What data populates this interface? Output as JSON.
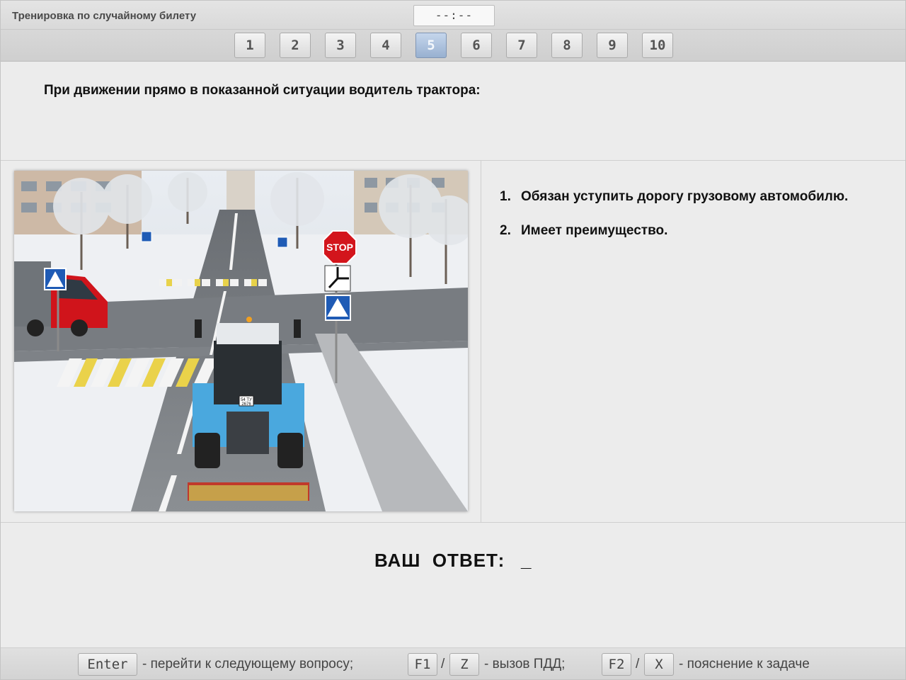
{
  "window": {
    "title": "Тренировка по случайному билету",
    "timer": "--:--"
  },
  "nav": {
    "questions": [
      "1",
      "2",
      "3",
      "4",
      "5",
      "6",
      "7",
      "8",
      "9",
      "10"
    ],
    "active_index": 4
  },
  "question": {
    "text": "При движении прямо в показанной ситуации водитель трактора:",
    "image": {
      "sign_stop": "STOP",
      "tractor_plate_top": "54 ТУ",
      "tractor_plate_bottom": "2676"
    },
    "answers": [
      {
        "number": "1.",
        "text": "Обязан уступить дорогу грузовому автомобилю."
      },
      {
        "number": "2.",
        "text": "Имеет преимущество."
      }
    ]
  },
  "answer_input": {
    "label": "ВАШ  ОТВЕТ:",
    "cursor": "_"
  },
  "footer": {
    "enter_key": "Enter",
    "enter_text": "- перейти к следующему вопросу;",
    "f1_key": "F1",
    "sep1": "/",
    "z_key": "Z",
    "rules_text": "- вызов ПДД;",
    "f2_key": "F2",
    "sep2": "/",
    "x_key": "X",
    "explain_text": "- пояснение к задаче"
  },
  "colors": {
    "active_button": "#98b0d0",
    "background": "#ececec"
  }
}
